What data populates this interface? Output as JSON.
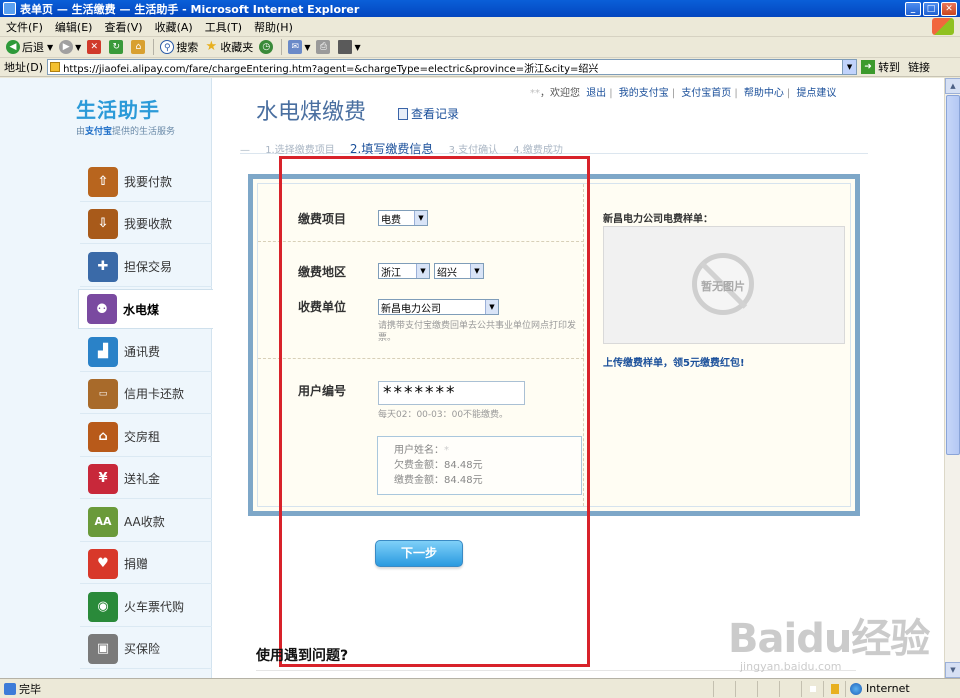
{
  "window": {
    "title": "表单页 — 生活缴费 — 生活助手 - Microsoft Internet Explorer"
  },
  "menu": [
    "文件(F)",
    "编辑(E)",
    "查看(V)",
    "收藏(A)",
    "工具(T)",
    "帮助(H)"
  ],
  "toolbar": {
    "back": "后退",
    "search": "搜索",
    "favorites": "收藏夹"
  },
  "address": {
    "label": "地址(D)",
    "url": "https://jiaofei.alipay.com/fare/chargeEntering.htm?agent=&chargeType=electric&province=浙江&city=绍兴",
    "go": "转到",
    "links": "链接"
  },
  "status": {
    "text": "完毕",
    "zone": "Internet"
  },
  "sidebar": {
    "logo_main": "生活助手",
    "logo_sub_prefix": "由",
    "logo_sub_brand": "支付宝",
    "logo_sub_suffix": "提供的生活服务",
    "items": [
      {
        "label": "我要付款",
        "icon": "pay-icon",
        "color": "#b8651e"
      },
      {
        "label": "我要收款",
        "icon": "receive-icon",
        "color": "#a85a1a"
      },
      {
        "label": "担保交易",
        "icon": "guarantee-icon",
        "color": "#3a6aa8"
      },
      {
        "label": "水电煤",
        "icon": "utilities-icon",
        "color": "#7a4aa0"
      },
      {
        "label": "通讯费",
        "icon": "signal-icon",
        "color": "#2a82c8"
      },
      {
        "label": "信用卡还款",
        "icon": "credit-card-icon",
        "color": "#a86a2a"
      },
      {
        "label": "交房租",
        "icon": "house-icon",
        "color": "#b85a1a"
      },
      {
        "label": "送礼金",
        "icon": "gift-icon",
        "color": "#c8283a"
      },
      {
        "label": "AA收款",
        "icon": "aa-icon",
        "color": "#6a9a3a"
      },
      {
        "label": "捐赠",
        "icon": "heart-icon",
        "color": "#d8382a"
      },
      {
        "label": "火车票代购",
        "icon": "train-icon",
        "color": "#2a8a3a"
      },
      {
        "label": "买保险",
        "icon": "safe-icon",
        "color": "#7a7a7a"
      }
    ]
  },
  "header": {
    "title": "水电煤缴费",
    "record_link": "查看记录",
    "user_name": "**",
    "welcome": "，欢迎您",
    "logout": "退出",
    "my_alipay": "我的支付宝",
    "alipay_home": "支付宝首页",
    "help": "帮助中心",
    "suggest": "提点建议"
  },
  "steps": [
    {
      "label": "1.选择缴费项目"
    },
    {
      "label": "2.填写缴费信息"
    },
    {
      "label": "3.支付确认"
    },
    {
      "label": "4.缴费成功"
    }
  ],
  "form": {
    "item_label": "缴费项目",
    "item_value": "电费",
    "region_label": "缴费地区",
    "province_value": "浙江",
    "city_value": "绍兴",
    "unit_label": "收费单位",
    "unit_value": "新昌电力公司",
    "unit_hint": "请携带支付宝缴费回单去公共事业单位网点打印发票。",
    "account_label": "用户编号",
    "account_value": "*******",
    "account_hint": "每天02：00-03：00不能缴费。",
    "info_name_label": "用户姓名：",
    "info_name_value": "*",
    "info_owed_label": "欠费金额：",
    "info_owed_value": "84.48元",
    "info_pay_label": "缴费金额：",
    "info_pay_value": "84.48元"
  },
  "sample": {
    "title": "新昌电力公司电费样单：",
    "no_image": "暂无图片",
    "upload_link": "上传缴费样单，领5元缴费红包!"
  },
  "next_button": "下一步",
  "faq_title": "使用遇到问题?",
  "watermark": {
    "main": "Baidu经验",
    "sub": "jingyan.baidu.com"
  }
}
